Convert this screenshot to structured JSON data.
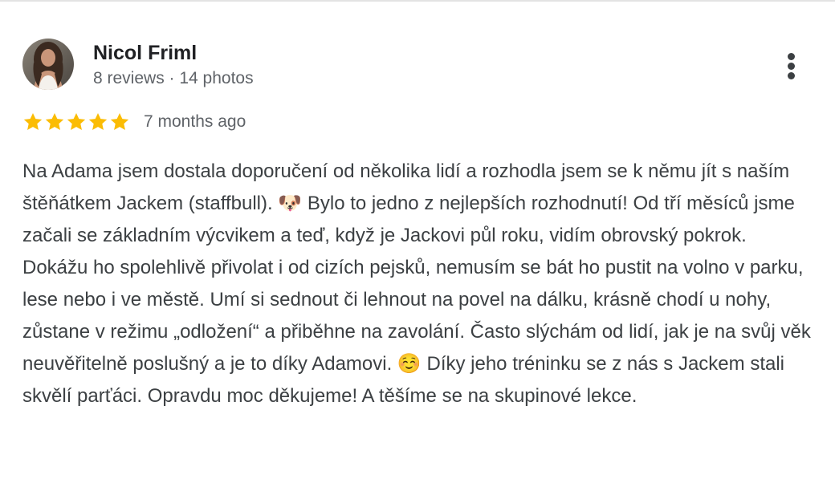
{
  "review": {
    "author": {
      "name": "Nicol Friml",
      "meta": "8 reviews · 14 photos"
    },
    "rating": 5,
    "rating_max": 5,
    "time": "7 months ago",
    "text": "Na Adama jsem dostala doporučení od několika lidí a rozhodla jsem se k němu jít s naším štěňátkem Jackem (staffbull). 🐶 Bylo to jedno z nejlepších rozhodnutí! Od tří měsíců jsme začali se základním výcvikem a teď, když je Jackovi půl roku, vidím obrovský pokrok. Dokážu ho spolehlivě přivolat i od cizích pejsků, nemusím se bát ho pustit na volno v parku, lese nebo i ve městě. Umí si sednout či lehnout na povel na dálku, krásně chodí u nohy, zůstane v režimu „odložení“ a přiběhne na zavolání. Často slýchám od lidí, jak je na svůj věk neuvěřitelně poslušný a je to díky Adamovi. ☺️ Díky jeho tréninku se z nás s Jackem stali skvělí parťáci. Opravdu moc děkujeme! A těšíme se na skupinové lekce."
  },
  "icons": {
    "more": "more-vert-icon",
    "star": "star-icon"
  },
  "colors": {
    "star": "#fbbc04",
    "name": "#202124",
    "meta": "#5f6368",
    "body_text": "#3c4043",
    "divider": "#e3e3e3"
  }
}
